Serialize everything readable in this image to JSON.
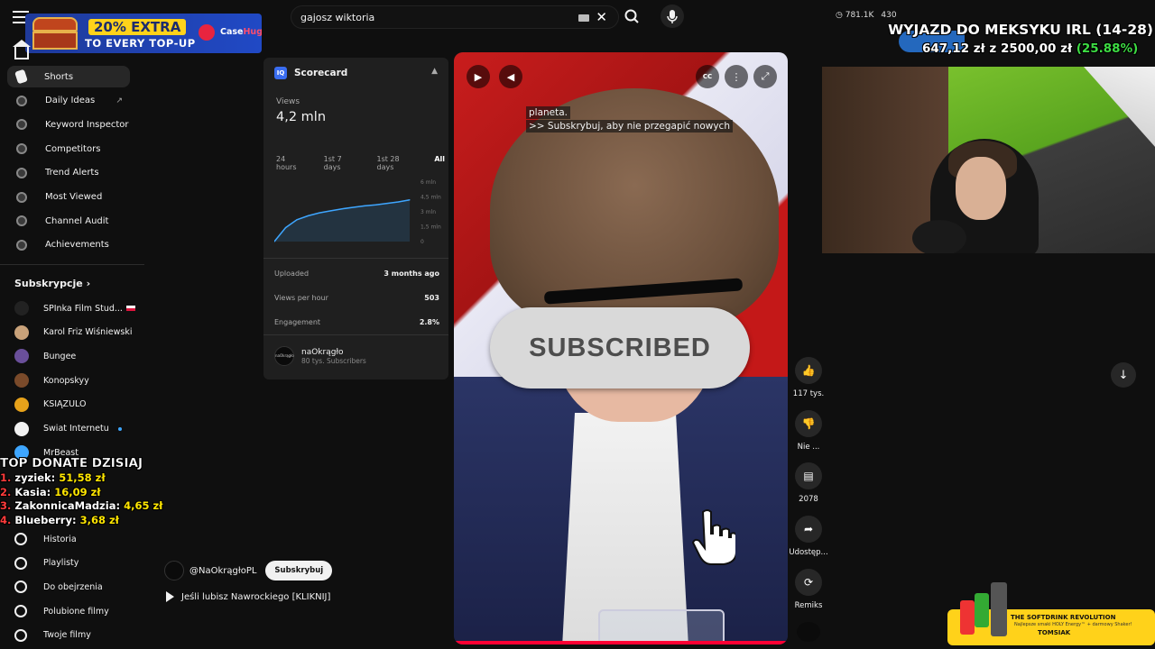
{
  "search": {
    "value": "gajosz wiktoria"
  },
  "header_stats": {
    "views": "781.1K",
    "count2": "430"
  },
  "promo": {
    "line1": "20% EXTRA",
    "line2": "TO EVERY TOP-UP",
    "brand_a": "Case",
    "brand_b": "Hug",
    "locale": "PL"
  },
  "sidebar": {
    "items": [
      {
        "label": "Shorts",
        "icon": "shorts-icon",
        "active": true
      },
      {
        "label": "Daily Ideas",
        "icon": "vidiq-icon",
        "external": "↗"
      },
      {
        "label": "Keyword Inspector",
        "icon": "vidiq-icon"
      },
      {
        "label": "Competitors",
        "icon": "vidiq-icon"
      },
      {
        "label": "Trend Alerts",
        "icon": "vidiq-icon"
      },
      {
        "label": "Most Viewed",
        "icon": "vidiq-icon"
      },
      {
        "label": "Channel Audit",
        "icon": "vidiq-icon"
      },
      {
        "label": "Achievements",
        "icon": "vidiq-icon"
      }
    ],
    "subscriptions_title": "Subskrypcje",
    "subscriptions": [
      {
        "label": "SPInka Film Stud...",
        "color": "#222222"
      },
      {
        "label": "Karol Friz Wiśniewski",
        "color": "#c9a27a"
      },
      {
        "label": "Bungee",
        "color": "#6a4f9a"
      },
      {
        "label": "Konopskyy",
        "color": "#7a4a2a"
      },
      {
        "label": "KSIĄŻULO",
        "color": "#e7a21a"
      },
      {
        "label": "Świat Internetu",
        "color": "#f1f1f1"
      },
      {
        "label": "MrBeast",
        "color": "#3ea6ff"
      }
    ],
    "library": [
      {
        "label": "Historia",
        "icon": "history-icon"
      },
      {
        "label": "Playlisty",
        "icon": "playlist-icon"
      },
      {
        "label": "Do obejrzenia",
        "icon": "clock-icon"
      },
      {
        "label": "Polubione filmy",
        "icon": "thumbs-up-icon"
      },
      {
        "label": "Twoje filmy",
        "icon": "video-icon"
      }
    ]
  },
  "donate": {
    "title": "TOP DONATE DZISIAJ",
    "rows": [
      {
        "n": "1.",
        "name": "zyziek:",
        "amount": "51,58 zł"
      },
      {
        "n": "2.",
        "name": "Kasia:",
        "amount": "16,09 zł"
      },
      {
        "n": "3.",
        "name": "ZakonnicaMadzia:",
        "amount": "4,65 zł"
      },
      {
        "n": "4.",
        "name": "Blueberry:",
        "amount": "3,68 zł"
      }
    ]
  },
  "scorecard": {
    "title": "Scorecard",
    "logo": "IQ",
    "views_label": "Views",
    "views_value": "4,2 mln",
    "tabs": [
      "24 hours",
      "1st 7 days",
      "1st 28 days",
      "All"
    ],
    "active_tab": "All",
    "rows": [
      {
        "k": "Uploaded",
        "v": "3 months ago"
      },
      {
        "k": "Views per hour",
        "v": "503"
      },
      {
        "k": "Engagement",
        "v": "2.8%"
      }
    ],
    "channel": {
      "name": "naOkrągło",
      "subs": "80 tys. Subscribers",
      "avatar_text": "naOkrągło"
    }
  },
  "chart_data": {
    "type": "area",
    "yticks": [
      "6 mln",
      "4,5 mln",
      "3 mln",
      "1,5 mln",
      "0"
    ],
    "ylim": [
      0,
      6
    ],
    "x": [
      0,
      1,
      2,
      3,
      4,
      5,
      6,
      7,
      8,
      9,
      10,
      11,
      12
    ],
    "values": [
      0,
      1.4,
      2.2,
      2.6,
      2.9,
      3.1,
      3.3,
      3.45,
      3.6,
      3.7,
      3.85,
      4.0,
      4.2
    ],
    "color": "#3ea6ff"
  },
  "video": {
    "caption_1": "planeta.",
    "caption_2": ">> Subskrybuj, aby nie przegapić nowych",
    "subscribed_label": "SUBSCRIBED",
    "channel_handle": "@NaOkrągłoPL",
    "subscribe_btn": "Subskrybuj",
    "playlist_title": "Jeśli lubisz Nawrockiego [KLIKNIJ]"
  },
  "actions": [
    {
      "label": "117 tys.",
      "icon": "thumbs-up-icon"
    },
    {
      "label": "Nie ...",
      "icon": "thumbs-down-icon"
    },
    {
      "label": "2078",
      "icon": "comment-icon"
    },
    {
      "label": "Udostęp...",
      "icon": "share-icon"
    },
    {
      "label": "Remiks",
      "icon": "remix-icon"
    }
  ],
  "goal": {
    "title": "WYJAZD DO MEKSYKU IRL (14-28)",
    "current": "647,12 zł",
    "sep": "z",
    "target": "2500,00 zł",
    "pct": "(25.88%)",
    "fraction": 0.2588
  },
  "sponsor": {
    "line1": "THE SOFTDRINK REVOLUTION",
    "line2": "Najlepsze smaki HOLY Energy™ + darmowy Shaker!",
    "line3": "TOMSIAK"
  }
}
